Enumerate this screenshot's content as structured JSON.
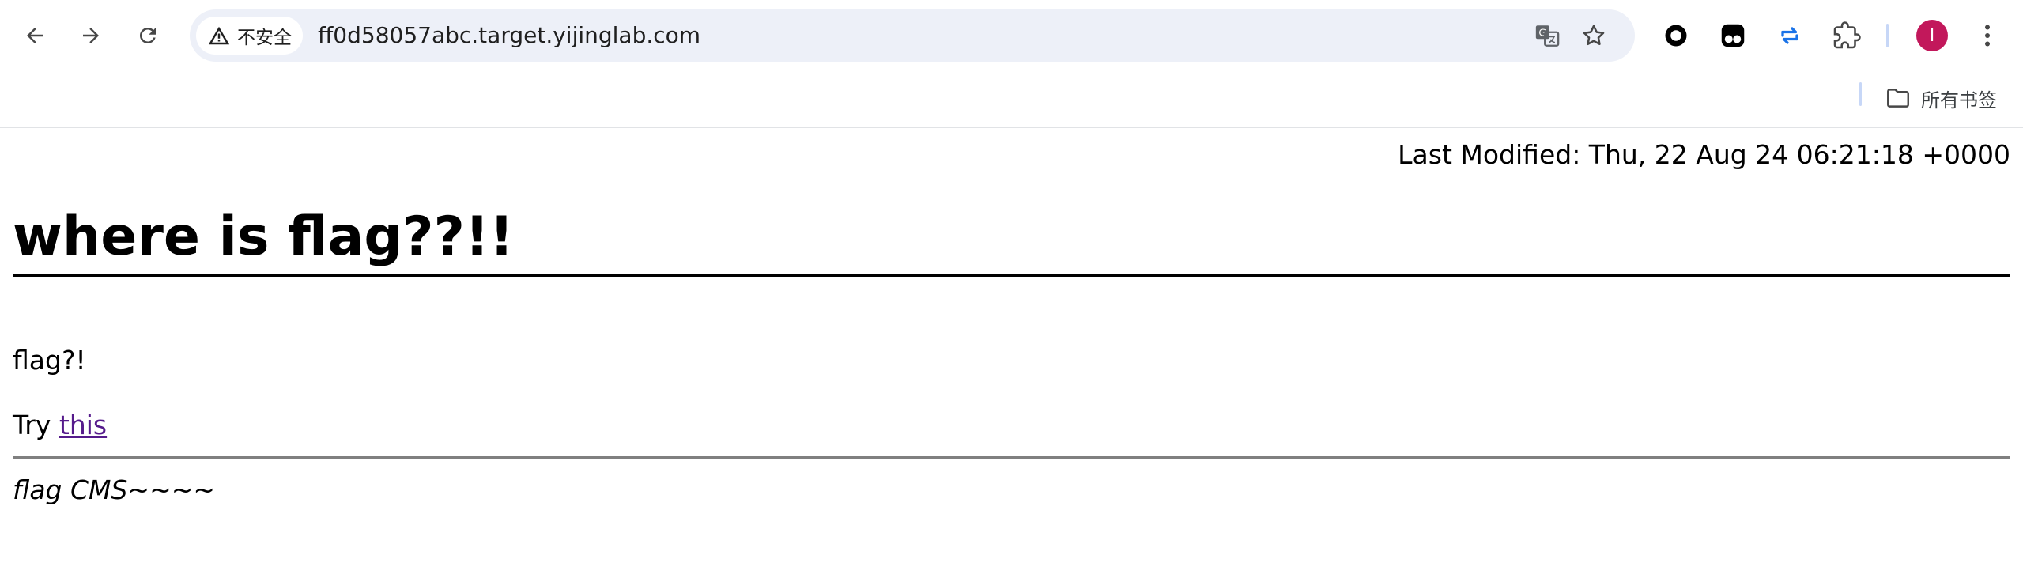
{
  "browser": {
    "security_label": "不安全",
    "url": "ff0d58057abc.target.yijinglab.com",
    "icons": {
      "back": "back-arrow-icon",
      "forward": "forward-arrow-icon",
      "reload": "reload-icon",
      "warning": "warning-triangle-icon",
      "translate": "translate-icon",
      "bookmark_star": "star-icon",
      "menu": "kebab-menu-icon"
    },
    "extensions": [
      "circle-extension-icon",
      "tampermonkey-icon",
      "repeat-extension-icon",
      "puzzle-extensions-icon"
    ],
    "profile_initial": "I",
    "profile_color": "#c2185b",
    "omnibox_color": "#edf0f8"
  },
  "bookmarks_bar": {
    "all_bookmarks_label": "所有书签",
    "icon": "folder-icon"
  },
  "page": {
    "last_modified": "Last Modified: Thu, 22 Aug 24 06:21:18 +0000",
    "heading": "where is flag??!!",
    "paragraph1": "flag?!",
    "try_prefix": "Try ",
    "try_link": "this",
    "link_color": "#551a8b",
    "footer": "flag CMS~~~~"
  }
}
